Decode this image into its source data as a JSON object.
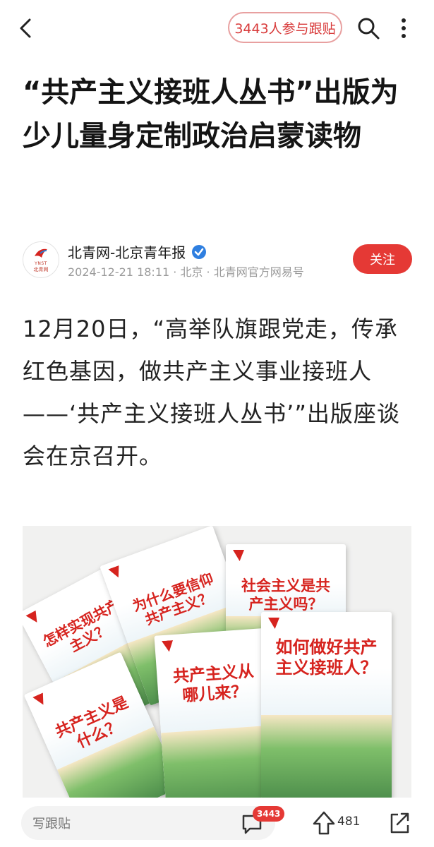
{
  "header": {
    "participants_label": "3443人参与跟贴"
  },
  "article": {
    "title": "“共产主义接班人丛书”出版为少儿量身定制政治启蒙读物",
    "source": "北青网-北京青年报",
    "meta": "2024-12-21 18:11 · 北京 · 北青网官方网易号",
    "follow_label": "关注",
    "avatar_text_en": "YNST",
    "avatar_text_cn": "北青网",
    "body": "12月20日，“高举队旗跟党走，传承红色基因，做共产主义事业接班人——‘共产主义接班人丛书’”出版座谈会在京召开。"
  },
  "photo": {
    "books": [
      {
        "title": "怎样实现共产主义？"
      },
      {
        "title": "为什么要信仰共产主义？"
      },
      {
        "title": "社会主义是共产主义吗？"
      },
      {
        "title": "共产主义是什么？"
      },
      {
        "title": "共产主义从哪儿来？"
      },
      {
        "title": "如何做好共产主义接班人？"
      }
    ]
  },
  "footer": {
    "comment_placeholder": "写跟贴",
    "comment_count": "3443",
    "upvote_count": "481"
  },
  "icons": {
    "back": "back-chevron-icon",
    "search": "search-icon",
    "more": "more-vertical-icon",
    "verified": "verified-check-icon",
    "comment": "comment-bubble-icon",
    "upvote": "upvote-arrow-icon",
    "share": "share-icon"
  },
  "colors": {
    "accent": "#e53935",
    "pill_border": "#e8a0a0",
    "verified": "#2f7fe0",
    "meta_text": "#9a9a9a"
  }
}
